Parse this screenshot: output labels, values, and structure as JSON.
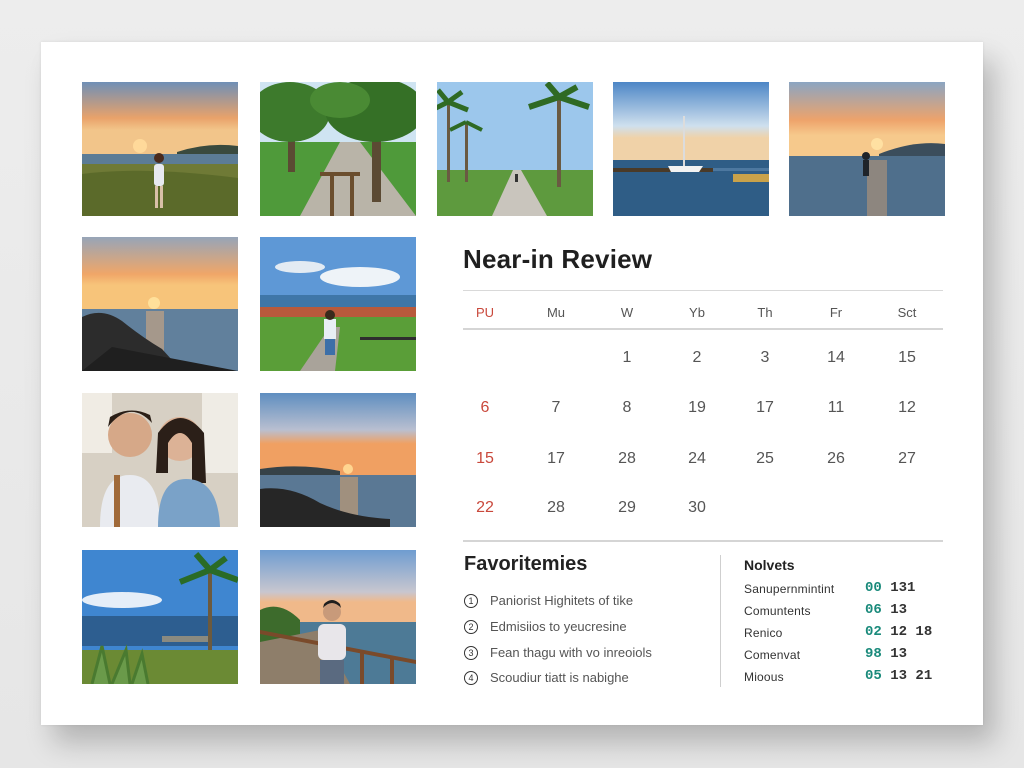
{
  "review": {
    "title": "Near-in Review",
    "weekdays": [
      "PU",
      "Mu",
      "W",
      "Yb",
      "Th",
      "Fr",
      "Sct"
    ],
    "rows": [
      [
        "",
        "",
        "1",
        "2",
        "3",
        "14",
        "15"
      ],
      [
        "6",
        "7",
        "8",
        "19",
        "17",
        "11",
        "12"
      ],
      [
        "15",
        "17",
        "28",
        "24",
        "25",
        "26",
        "27"
      ],
      [
        "22",
        "28",
        "29",
        "30",
        "",
        "",
        ""
      ]
    ],
    "accent_color": "#c9483b"
  },
  "favorites": {
    "title": "Favoritemies",
    "items": [
      {
        "num": "1",
        "text": "Paniorist Highitets of tike"
      },
      {
        "num": "2",
        "text": "Edmisiios to yeucresine"
      },
      {
        "num": "3",
        "text": "Fean thagu with vo inreoiols"
      },
      {
        "num": "4",
        "text": "Scoudiur tiatt is nabighe"
      }
    ]
  },
  "novelts": {
    "title": "Nolvets",
    "teal_color": "#1a8a7b",
    "rows": [
      {
        "label": "Sanupernmintint",
        "lead": "00",
        "rest": " 131"
      },
      {
        "label": "Comuntents",
        "lead": "06",
        "rest": " 13"
      },
      {
        "label": "Renico",
        "lead": "02",
        "rest": " 12 18"
      },
      {
        "label": "Comenvat",
        "lead": "98",
        "rest": " 13"
      },
      {
        "label": "Mioous",
        "lead": "05",
        "rest": " 13 21"
      }
    ]
  },
  "photos": [
    {
      "name": "sunset-woman-meadow-photo"
    },
    {
      "name": "park-trees-path-photo"
    },
    {
      "name": "palm-promenade-photo"
    },
    {
      "name": "sailboat-pier-photo"
    },
    {
      "name": "sunset-wading-photo"
    },
    {
      "name": "sunset-rocky-shore-photo"
    },
    {
      "name": "coastal-town-walker-photo"
    },
    {
      "name": "couple-selfie-photo"
    },
    {
      "name": "sunset-shore-rocks-photo"
    },
    {
      "name": "palm-coast-agave-photo"
    },
    {
      "name": "boardwalk-man-photo"
    }
  ]
}
